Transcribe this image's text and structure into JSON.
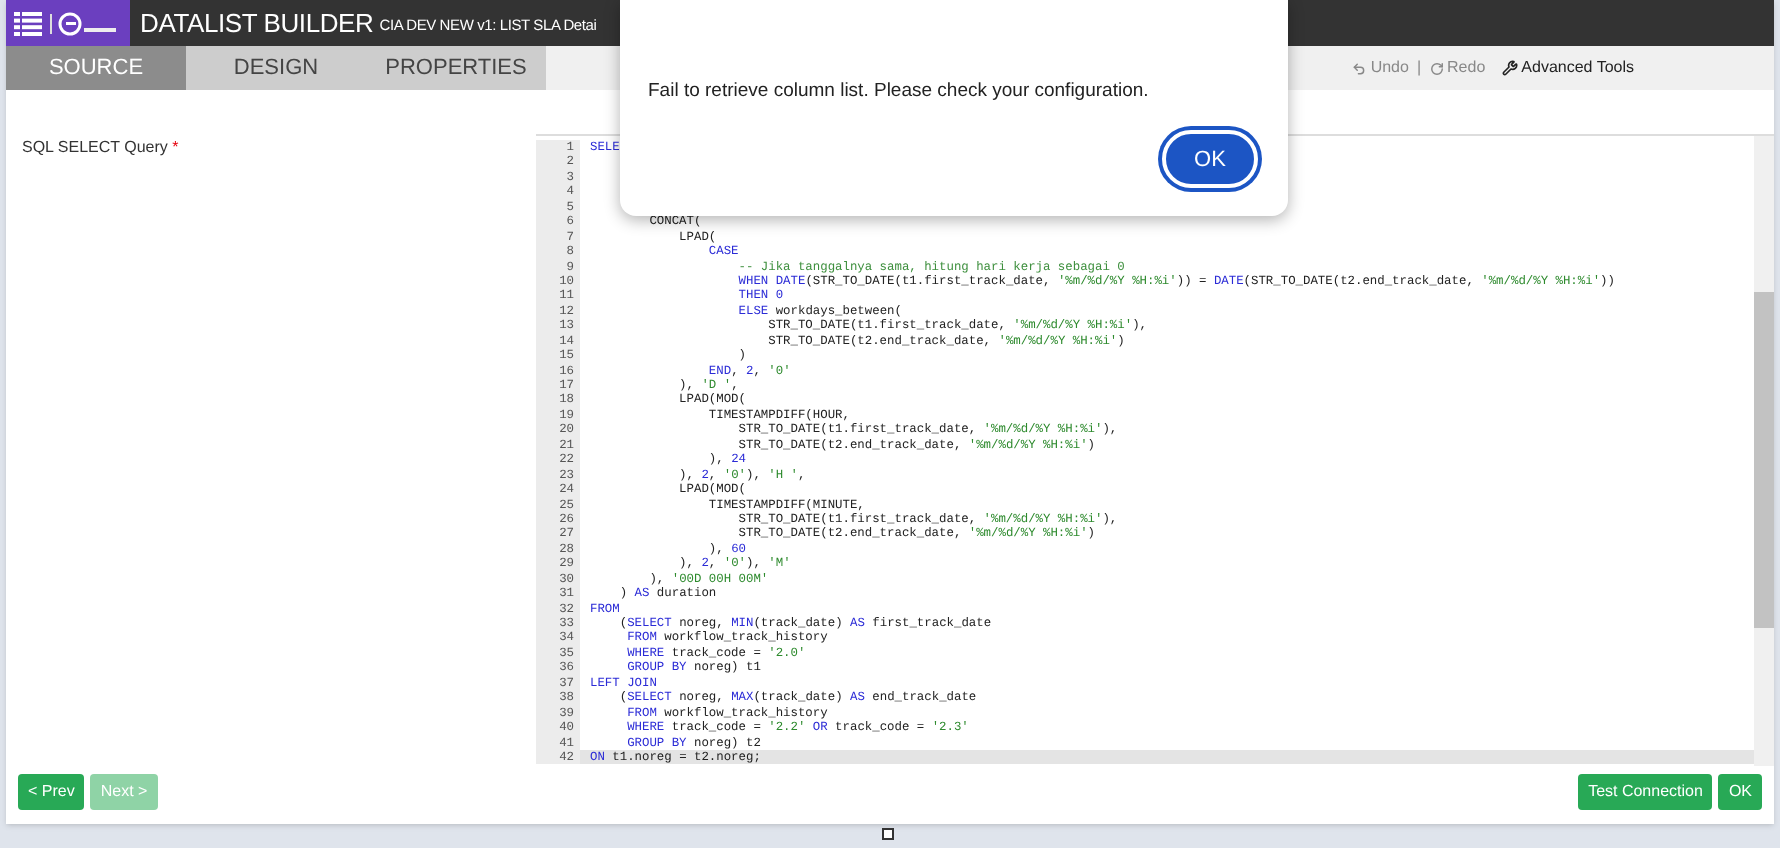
{
  "header": {
    "title": "DATALIST BUILDER",
    "subtitle": "CIA DEV NEW v1: LIST SLA Detai"
  },
  "steps": [
    {
      "label": "SOURCE",
      "selected": true
    },
    {
      "label": "DESIGN",
      "selected": false
    },
    {
      "label": "PROPERTIES",
      "selected": false
    }
  ],
  "toolbar": {
    "undo": "Undo",
    "separator": "|",
    "redo": "Redo",
    "advanced": "Advanced Tools"
  },
  "field": {
    "label": "SQL SELECT Query",
    "required": "*"
  },
  "code_lines": [
    {
      "number": "1",
      "current": false,
      "segments": [
        {
          "kind": "keyword",
          "text": "SELE"
        }
      ]
    },
    {
      "number": "2",
      "current": false
    },
    {
      "number": "3",
      "current": false
    },
    {
      "number": "4",
      "current": false
    },
    {
      "number": "5",
      "current": false
    },
    {
      "number": "6",
      "current": false,
      "segments": [
        {
          "kind": "plain",
          "text": "        CONCAT("
        }
      ]
    },
    {
      "number": "7",
      "current": false,
      "segments": [
        {
          "kind": "plain",
          "text": "            LPAD("
        }
      ]
    },
    {
      "number": "8",
      "current": false,
      "segments": [
        {
          "kind": "keyword",
          "text": "                CASE"
        }
      ]
    },
    {
      "number": "9",
      "current": false,
      "segments": [
        {
          "kind": "comment",
          "text": "                    -- Jika tanggalnya sama, hitung hari kerja sebagai 0"
        }
      ]
    },
    {
      "number": "10",
      "current": false,
      "segments": [
        {
          "kind": "keyword",
          "text": "                    WHEN DATE"
        },
        {
          "kind": "plain",
          "text": "(STR_TO_DATE(t1.first_track_date, "
        },
        {
          "kind": "string",
          "text": "'%m/%d/%Y %H:%i'"
        },
        {
          "kind": "plain",
          "text": ")) = "
        },
        {
          "kind": "keyword",
          "text": "DATE"
        },
        {
          "kind": "plain",
          "text": "(STR_TO_DATE(t2.end_track_date, "
        },
        {
          "kind": "string",
          "text": "'%m/%d/%Y %H:%i'"
        },
        {
          "kind": "plain",
          "text": "))"
        }
      ]
    },
    {
      "number": "11",
      "current": false,
      "segments": [
        {
          "kind": "keyword",
          "text": "                    THEN 0"
        }
      ]
    },
    {
      "number": "12",
      "current": false,
      "segments": [
        {
          "kind": "keyword",
          "text": "                    ELSE"
        },
        {
          "kind": "plain",
          "text": " workdays_between("
        }
      ]
    },
    {
      "number": "13",
      "current": false,
      "segments": [
        {
          "kind": "plain",
          "text": "                        STR_TO_DATE(t1.first_track_date, "
        },
        {
          "kind": "string",
          "text": "'%m/%d/%Y %H:%i'"
        },
        {
          "kind": "plain",
          "text": "),"
        }
      ]
    },
    {
      "number": "14",
      "current": false,
      "segments": [
        {
          "kind": "plain",
          "text": "                        STR_TO_DATE(t2.end_track_date, "
        },
        {
          "kind": "string",
          "text": "'%m/%d/%Y %H:%i'"
        },
        {
          "kind": "plain",
          "text": ")"
        }
      ]
    },
    {
      "number": "15",
      "current": false,
      "segments": [
        {
          "kind": "plain",
          "text": "                    )"
        }
      ]
    },
    {
      "number": "16",
      "current": false,
      "segments": [
        {
          "kind": "keyword",
          "text": "                END"
        },
        {
          "kind": "plain",
          "text": ", "
        },
        {
          "kind": "number",
          "text": "2"
        },
        {
          "kind": "plain",
          "text": ", "
        },
        {
          "kind": "string",
          "text": "'0'"
        }
      ]
    },
    {
      "number": "17",
      "current": false,
      "segments": [
        {
          "kind": "plain",
          "text": "            ), "
        },
        {
          "kind": "string",
          "text": "'D '"
        },
        {
          "kind": "plain",
          "text": ","
        }
      ]
    },
    {
      "number": "18",
      "current": false,
      "segments": [
        {
          "kind": "plain",
          "text": "            LPAD(MOD("
        }
      ]
    },
    {
      "number": "19",
      "current": false,
      "segments": [
        {
          "kind": "plain",
          "text": "                TIMESTAMPDIFF(HOUR,"
        }
      ]
    },
    {
      "number": "20",
      "current": false,
      "segments": [
        {
          "kind": "plain",
          "text": "                    STR_TO_DATE(t1.first_track_date, "
        },
        {
          "kind": "string",
          "text": "'%m/%d/%Y %H:%i'"
        },
        {
          "kind": "plain",
          "text": "),"
        }
      ]
    },
    {
      "number": "21",
      "current": false,
      "segments": [
        {
          "kind": "plain",
          "text": "                    STR_TO_DATE(t2.end_track_date, "
        },
        {
          "kind": "string",
          "text": "'%m/%d/%Y %H:%i'"
        },
        {
          "kind": "plain",
          "text": ")"
        }
      ]
    },
    {
      "number": "22",
      "current": false,
      "segments": [
        {
          "kind": "plain",
          "text": "                ), "
        },
        {
          "kind": "number",
          "text": "24"
        }
      ]
    },
    {
      "number": "23",
      "current": false,
      "segments": [
        {
          "kind": "plain",
          "text": "            ), "
        },
        {
          "kind": "number",
          "text": "2"
        },
        {
          "kind": "plain",
          "text": ", "
        },
        {
          "kind": "string",
          "text": "'0'"
        },
        {
          "kind": "plain",
          "text": "), "
        },
        {
          "kind": "string",
          "text": "'H '"
        },
        {
          "kind": "plain",
          "text": ","
        }
      ]
    },
    {
      "number": "24",
      "current": false,
      "segments": [
        {
          "kind": "plain",
          "text": "            LPAD(MOD("
        }
      ]
    },
    {
      "number": "25",
      "current": false,
      "segments": [
        {
          "kind": "plain",
          "text": "                TIMESTAMPDIFF(MINUTE,"
        }
      ]
    },
    {
      "number": "26",
      "current": false,
      "segments": [
        {
          "kind": "plain",
          "text": "                    STR_TO_DATE(t1.first_track_date, "
        },
        {
          "kind": "string",
          "text": "'%m/%d/%Y %H:%i'"
        },
        {
          "kind": "plain",
          "text": "),"
        }
      ]
    },
    {
      "number": "27",
      "current": false,
      "segments": [
        {
          "kind": "plain",
          "text": "                    STR_TO_DATE(t2.end_track_date, "
        },
        {
          "kind": "string",
          "text": "'%m/%d/%Y %H:%i'"
        },
        {
          "kind": "plain",
          "text": ")"
        }
      ]
    },
    {
      "number": "28",
      "current": false,
      "segments": [
        {
          "kind": "plain",
          "text": "                ), "
        },
        {
          "kind": "number",
          "text": "60"
        }
      ]
    },
    {
      "number": "29",
      "current": false,
      "segments": [
        {
          "kind": "plain",
          "text": "            ), "
        },
        {
          "kind": "number",
          "text": "2"
        },
        {
          "kind": "plain",
          "text": ", "
        },
        {
          "kind": "string",
          "text": "'0'"
        },
        {
          "kind": "plain",
          "text": "), "
        },
        {
          "kind": "string",
          "text": "'M'"
        }
      ]
    },
    {
      "number": "30",
      "current": false,
      "segments": [
        {
          "kind": "plain",
          "text": "        ), "
        },
        {
          "kind": "string",
          "text": "'00D 00H 00M'"
        }
      ]
    },
    {
      "number": "31",
      "current": false,
      "segments": [
        {
          "kind": "plain",
          "text": "    ) "
        },
        {
          "kind": "keyword",
          "text": "AS"
        },
        {
          "kind": "plain",
          "text": " duration"
        }
      ]
    },
    {
      "number": "32",
      "current": false,
      "segments": [
        {
          "kind": "keyword",
          "text": "FROM"
        }
      ]
    },
    {
      "number": "33",
      "current": false,
      "segments": [
        {
          "kind": "plain",
          "text": "    ("
        },
        {
          "kind": "keyword",
          "text": "SELECT"
        },
        {
          "kind": "plain",
          "text": " noreg, "
        },
        {
          "kind": "keyword",
          "text": "MIN"
        },
        {
          "kind": "plain",
          "text": "(track_date) "
        },
        {
          "kind": "keyword",
          "text": "AS"
        },
        {
          "kind": "plain",
          "text": " first_track_date"
        }
      ]
    },
    {
      "number": "34",
      "current": false,
      "segments": [
        {
          "kind": "keyword",
          "text": "     FROM"
        },
        {
          "kind": "plain",
          "text": " workflow_track_history"
        }
      ]
    },
    {
      "number": "35",
      "current": false,
      "segments": [
        {
          "kind": "keyword",
          "text": "     WHERE"
        },
        {
          "kind": "plain",
          "text": " track_code = "
        },
        {
          "kind": "string",
          "text": "'2.0'"
        }
      ]
    },
    {
      "number": "36",
      "current": false,
      "segments": [
        {
          "kind": "keyword",
          "text": "     GROUP BY"
        },
        {
          "kind": "plain",
          "text": " noreg) t1"
        }
      ]
    },
    {
      "number": "37",
      "current": false,
      "segments": [
        {
          "kind": "keyword",
          "text": "LEFT JOIN"
        }
      ]
    },
    {
      "number": "38",
      "current": false,
      "segments": [
        {
          "kind": "plain",
          "text": "    ("
        },
        {
          "kind": "keyword",
          "text": "SELECT"
        },
        {
          "kind": "plain",
          "text": " noreg, "
        },
        {
          "kind": "keyword",
          "text": "MAX"
        },
        {
          "kind": "plain",
          "text": "(track_date) "
        },
        {
          "kind": "keyword",
          "text": "AS"
        },
        {
          "kind": "plain",
          "text": " end_track_date"
        }
      ]
    },
    {
      "number": "39",
      "current": false,
      "segments": [
        {
          "kind": "keyword",
          "text": "     FROM"
        },
        {
          "kind": "plain",
          "text": " workflow_track_history"
        }
      ]
    },
    {
      "number": "40",
      "current": false,
      "segments": [
        {
          "kind": "keyword",
          "text": "     WHERE"
        },
        {
          "kind": "plain",
          "text": " track_code = "
        },
        {
          "kind": "string",
          "text": "'2.2'"
        },
        {
          "kind": "keyword",
          "text": " OR"
        },
        {
          "kind": "plain",
          "text": " track_code = "
        },
        {
          "kind": "string",
          "text": "'2.3'"
        }
      ]
    },
    {
      "number": "41",
      "current": false,
      "segments": [
        {
          "kind": "keyword",
          "text": "     GROUP BY"
        },
        {
          "kind": "plain",
          "text": " noreg) t2"
        }
      ]
    },
    {
      "number": "42",
      "current": true,
      "segments": [
        {
          "kind": "keyword",
          "text": "ON"
        },
        {
          "kind": "plain",
          "text": " t1.noreg = t2.noreg;"
        }
      ]
    }
  ],
  "footer": {
    "left": [
      {
        "label": "< Prev",
        "disabled": false
      },
      {
        "label": "Next >",
        "disabled": true
      }
    ],
    "right": [
      {
        "label": "Test Connection",
        "disabled": false
      },
      {
        "label": "OK",
        "disabled": false
      }
    ]
  },
  "alert": {
    "message": "Fail to retrieve column list. Please check your configuration.",
    "button": "OK"
  }
}
